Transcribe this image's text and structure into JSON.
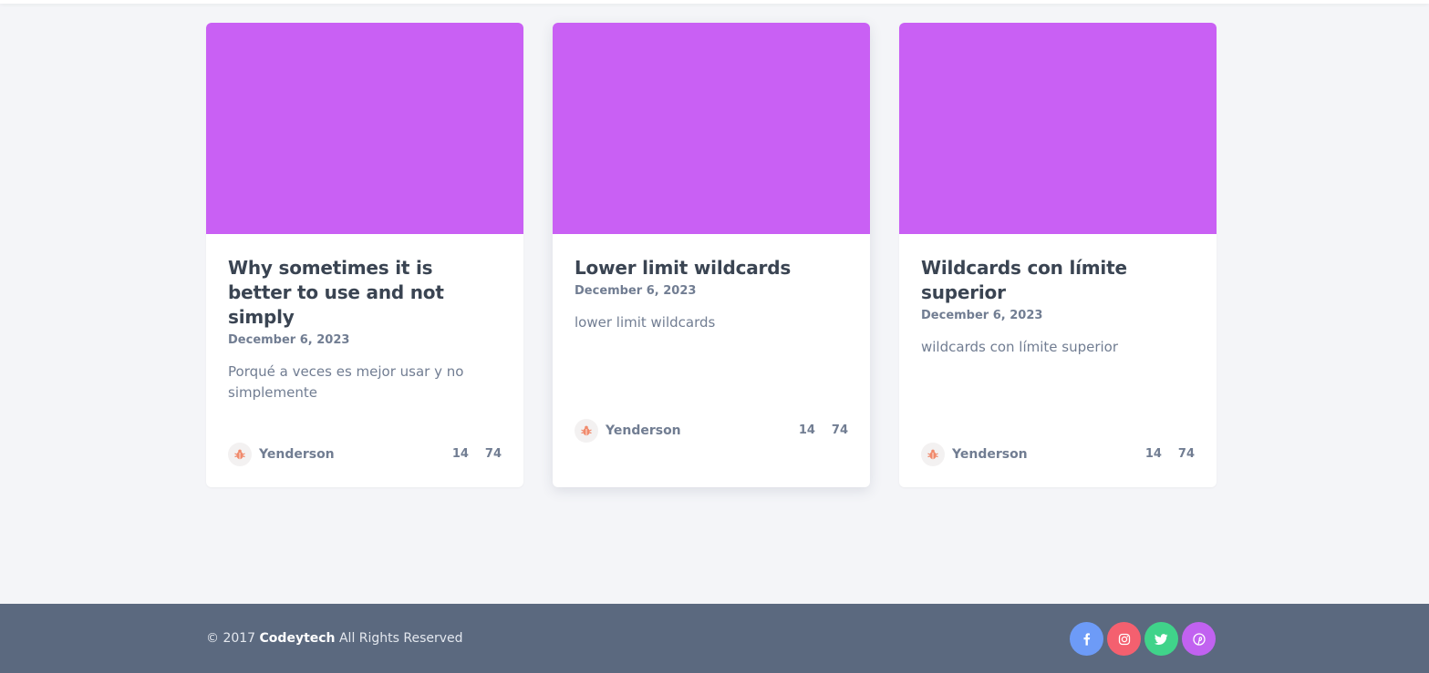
{
  "cards": [
    {
      "title": "Why sometimes it is better to use and not simply",
      "date": "December 6, 2023",
      "description": "Porqué a veces es mejor usar y no simplemente",
      "author": "Yenderson",
      "stat_a": "14",
      "stat_b": "74",
      "image_color": "#c960f4"
    },
    {
      "title": "Lower limit wildcards",
      "date": "December 6, 2023",
      "description": "lower limit wildcards",
      "author": "Yenderson",
      "stat_a": "14",
      "stat_b": "74",
      "image_color": "#c960f4"
    },
    {
      "title": "Wildcards con límite superior",
      "date": "December 6, 2023",
      "description": "wildcards con límite superior",
      "author": "Yenderson",
      "stat_a": "14",
      "stat_b": "74",
      "image_color": "#c960f4"
    }
  ],
  "footer": {
    "copyright_prefix": "© 2017 ",
    "brand": "Codeytech",
    "copyright_suffix": " All Rights Reserved",
    "socials": [
      {
        "icon": "facebook-icon",
        "color": "#6d9bf7"
      },
      {
        "icon": "instagram-icon",
        "color": "#f4606f"
      },
      {
        "icon": "twitter-icon",
        "color": "#40d38a"
      },
      {
        "icon": "pinterest-icon",
        "color": "#c162f0"
      }
    ]
  },
  "colors": {
    "background": "#f4f5f8",
    "footer_bg": "#5b697f",
    "title_text": "#3a4452",
    "muted_text": "#717d92",
    "avatar_accent": "#f08a6c"
  }
}
